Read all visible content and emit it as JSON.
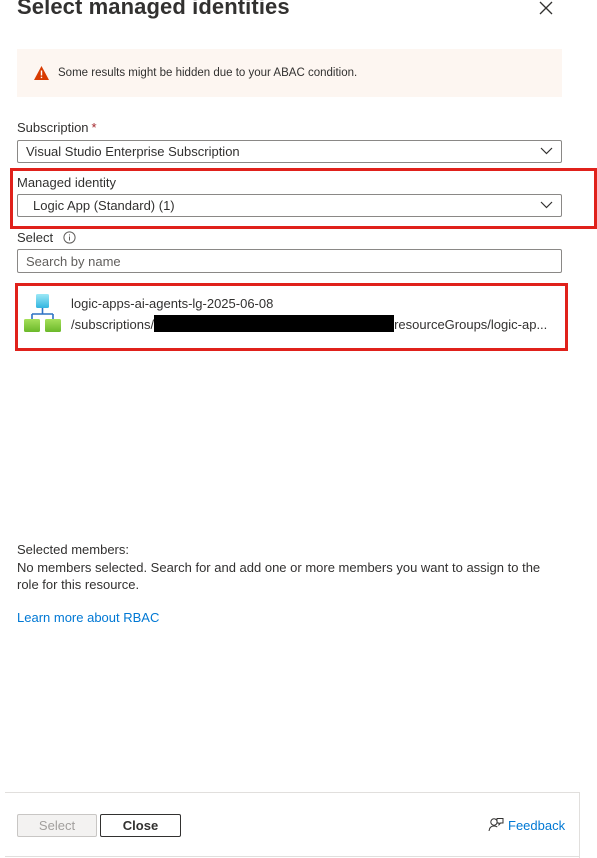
{
  "panel": {
    "title": "Select managed identities",
    "close_icon": "close-icon"
  },
  "warning": {
    "icon": "warning-icon",
    "text": "Some results might be hidden due to your ABAC condition.",
    "color": "#d83b01"
  },
  "subscription": {
    "label": "Subscription",
    "required_mark": "*",
    "value": "Visual Studio Enterprise Subscription"
  },
  "managed_identity": {
    "label": "Managed identity",
    "value": "Logic App (Standard) (1)"
  },
  "select": {
    "label": "Select",
    "info_icon": "info-icon",
    "placeholder": "Search by name"
  },
  "results": [
    {
      "icon": "logic-app-icon",
      "name": "logic-apps-ai-agents-lg-2025-06-08",
      "path_prefix": "/subscriptions/",
      "path_suffix": "resourceGroups/logic-ap..."
    }
  ],
  "selected_members": {
    "title": "Selected members:",
    "text": "No members selected. Search for and add one or more members you want to assign to the role for this resource.",
    "learn_more": "Learn more about RBAC"
  },
  "footer": {
    "select_label": "Select",
    "close_label": "Close",
    "feedback_label": "Feedback",
    "feedback_icon": "feedback-icon"
  },
  "colors": {
    "accent": "#0078d4",
    "highlight": "#e0211b",
    "warning_bg": "#fdf6f1"
  }
}
